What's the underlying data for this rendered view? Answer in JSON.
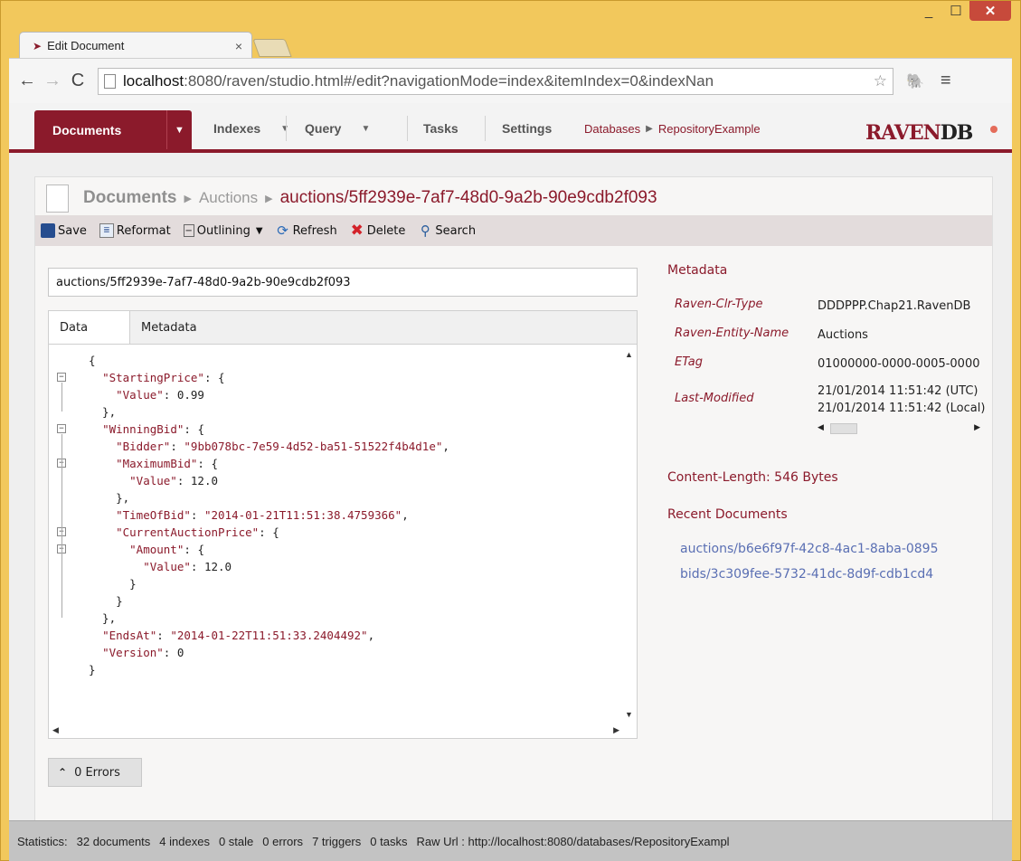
{
  "browser": {
    "tab_title": "Edit Document",
    "tab_close": "×",
    "url_host": "localhost",
    "url_rest": ":8080/raven/studio.html#/edit?navigationMode=index&itemIndex=0&indexNan",
    "min": "_",
    "max": "☐",
    "close": "✕"
  },
  "nav": {
    "documents": "Documents",
    "indexes": "Indexes",
    "query": "Query",
    "tasks": "Tasks",
    "settings": "Settings",
    "databases": "Databases",
    "db_name": "RepositoryExample",
    "logo_a": "RAVEN",
    "logo_b": "DB"
  },
  "breadcrumb": {
    "root": "Documents",
    "collection": "Auctions",
    "doc_id": "auctions/5ff2939e-7af7-48d0-9a2b-90e9cdb2f093"
  },
  "actions": {
    "save": "Save",
    "reformat": "Reformat",
    "outlining": "Outlining",
    "refresh": "Refresh",
    "delete": "Delete",
    "search": "Search"
  },
  "editor": {
    "id_value": "auctions/5ff2939e-7af7-48d0-9a2b-90e9cdb2f093",
    "tab_data": "Data",
    "tab_metadata": "Metadata",
    "lines": [
      "{",
      "  \"StartingPrice\": {",
      "    \"Value\": 0.99",
      "  },",
      "  \"WinningBid\": {",
      "    \"Bidder\": \"9bb078bc-7e59-4d52-ba51-51522f4b4d1e\",",
      "    \"MaximumBid\": {",
      "      \"Value\": 12.0",
      "    },",
      "    \"TimeOfBid\": \"2014-01-21T11:51:38.4759366\",",
      "    \"CurrentAuctionPrice\": {",
      "      \"Amount\": {",
      "        \"Value\": 12.0",
      "      }",
      "    }",
      "  },",
      "  \"EndsAt\": \"2014-01-22T11:51:33.2404492\",",
      "  \"Version\": 0",
      "}"
    ],
    "errors": "0 Errors"
  },
  "metadata": {
    "heading": "Metadata",
    "rows": [
      {
        "key": "Raven-Clr-Type",
        "val": "DDDPPP.Chap21.RavenDB"
      },
      {
        "key": "Raven-Entity-Name",
        "val": "Auctions"
      },
      {
        "key": "ETag",
        "val": "01000000-0000-0005-0000"
      },
      {
        "key": "Last-Modified",
        "val": "21/01/2014 11:51:42 (UTC)",
        "val2": "21/01/2014 11:51:42 (Local)"
      }
    ],
    "content_length": "Content-Length: 546 Bytes",
    "recent_heading": "Recent Documents",
    "recent": [
      "auctions/b6e6f97f-42c8-4ac1-8aba-0895",
      "bids/3c309fee-5732-41dc-8d9f-cdb1cd4"
    ]
  },
  "status": {
    "label": "Statistics:",
    "docs": "32 documents",
    "indexes": "4 indexes",
    "stale": "0 stale",
    "errors": "0 errors",
    "triggers": "7 triggers",
    "tasks": "0 tasks",
    "raw_url": "Raw Url : http://localhost:8080/databases/RepositoryExampl"
  }
}
